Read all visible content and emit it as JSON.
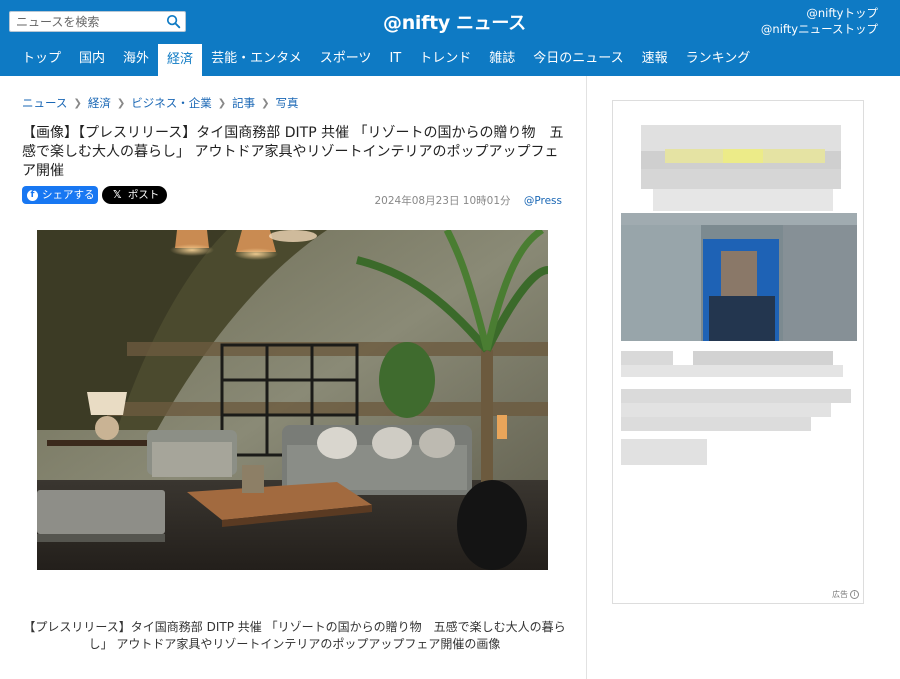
{
  "header": {
    "search_placeholder": "ニュースを検索",
    "logo_at": "@nifty",
    "logo_news": "ニュース",
    "links": [
      "@niftyトップ",
      "@niftyニューストップ"
    ]
  },
  "nav": {
    "items": [
      "トップ",
      "国内",
      "海外",
      "経済",
      "芸能・エンタメ",
      "スポーツ",
      "IT",
      "トレンド",
      "雑誌",
      "今日のニュース",
      "速報",
      "ランキング"
    ],
    "active": "経済"
  },
  "breadcrumb": [
    "ニュース",
    "経済",
    "ビジネス・企業",
    "記事",
    "写真"
  ],
  "article": {
    "title": "【画像】【プレスリリース】タイ国商務部 DITP 共催 「リゾートの国からの贈り物　五感で楽しむ大人の暮らし」 アウトドア家具やリゾートインテリアのポップアップフェア開催",
    "share_facebook": "シェアする",
    "share_x": "ポスト",
    "date": "2024年08月23日 10時01分",
    "source": "@Press",
    "caption": "【プレスリリース】タイ国商務部 DITP 共催 「リゾートの国からの贈り物　五感で楽しむ大人の暮らし」 アウトドア家具やリゾートインテリアのポップアップフェア開催の画像"
  },
  "ad": {
    "badge": "広告"
  },
  "colors": {
    "header_bg": "#0e7ac4",
    "link": "#1a67b5",
    "facebook": "#1877f2",
    "x": "#000000"
  }
}
